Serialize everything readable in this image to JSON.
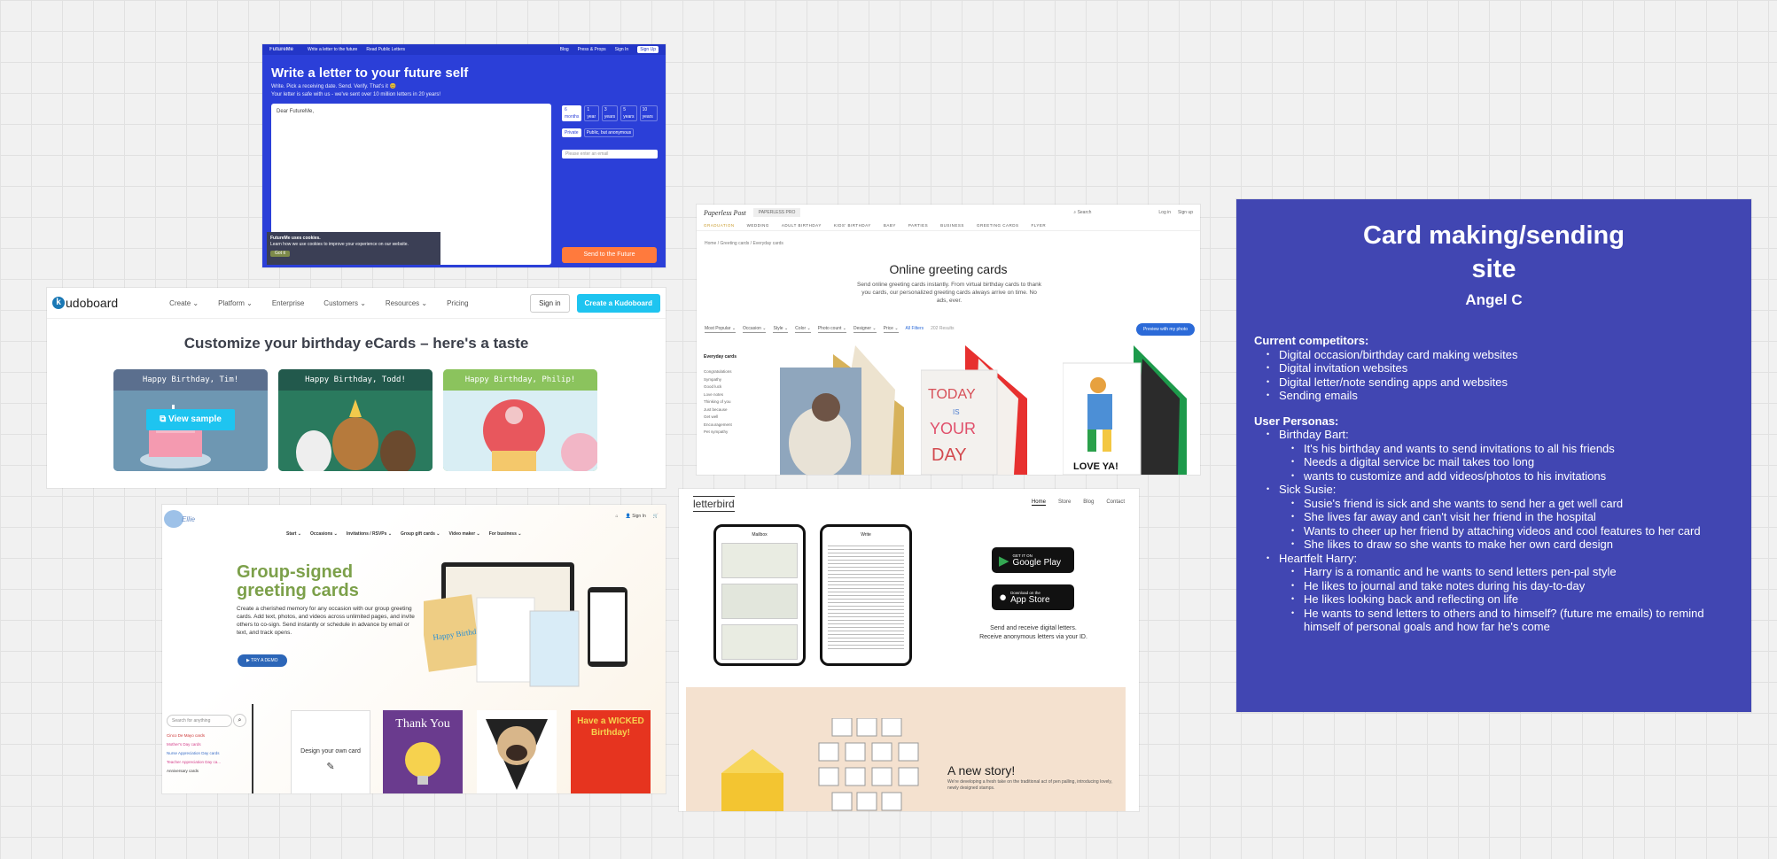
{
  "futureme": {
    "nav_logo": "FutureMe",
    "nav_links": [
      "Write a letter to the future",
      "Read Public Letters"
    ],
    "nav_right": [
      "Blog",
      "Press & Props"
    ],
    "sign_in": "Sign In",
    "sign_up": "Sign Up",
    "title": "Write a letter to your future self",
    "sub1": "Write. Pick a receiving date. Send. Verify. That's it 😊",
    "sub2": "Your letter is safe with us - we've sent over 10 million letters in 20 years!",
    "letter_placeholder": "Dear FutureMe,",
    "options": [
      "6 months",
      "1 year",
      "3 years",
      "5 years",
      "10 years"
    ],
    "privacy": [
      "Private",
      "Public, but anonymous"
    ],
    "email_placeholder": "Please enter an email",
    "cookie_title": "FutureMe uses cookies.",
    "cookie_text": "Learn how we use cookies to improve your experience on our website.",
    "cookie_btn": "Got it",
    "send": "Send to the Future"
  },
  "kudoboard": {
    "logo": "udoboard",
    "logo_k": "k",
    "menu": [
      "Create ⌄",
      "Platform ⌄",
      "Enterprise",
      "Customers ⌄",
      "Resources ⌄",
      "Pricing"
    ],
    "signin": "Sign in",
    "create": "Create a Kudoboard",
    "heading": "Customize your birthday eCards – here's a taste",
    "cards": [
      "Happy Birthday, Tim!",
      "Happy Birthday, Todd!",
      "Happy Birthday, Philip!"
    ],
    "view_sample": "View sample"
  },
  "greeting": {
    "logo1": "Paperless Post",
    "logo2": "PAPERLESS PRO",
    "search": "Search",
    "login": "Log in",
    "signup": "Sign up",
    "cats": [
      "GRADUATION",
      "WEDDING",
      "ADULT BIRTHDAY",
      "KIDS' BIRTHDAY",
      "BABY",
      "PARTIES",
      "BUSINESS",
      "GREETING CARDS",
      "FLYER"
    ],
    "breadcrumb": "Home  /  Greeting cards  /  Everyday cards",
    "title": "Online greeting cards",
    "desc": "Send online greeting cards instantly. From virtual birthday cards to thank you cards, our personalized greeting cards always arrive on time. No ads, ever.",
    "filters": [
      "Most Popular ⌄",
      "Occasion ⌄",
      "Style ⌄",
      "Color ⌄",
      "Photo count ⌄",
      "Designer ⌄",
      "Price ⌄",
      "All Filters",
      "202 Results"
    ],
    "preview": "Preview with my photo",
    "side_title": "Everyday cards",
    "side_items": [
      "Congratulations",
      "Sympathy",
      "Good luck",
      "Love notes",
      "Thinking of you",
      "Just because",
      "Get well",
      "Encouragement",
      "Pet sympathy"
    ],
    "card2_lines": [
      "TODAY",
      "IS",
      "YOUR",
      "DAY"
    ],
    "card3_text": "LOVE YA!"
  },
  "ellie": {
    "logo": "Ellie",
    "top_right": [
      "Sign In"
    ],
    "menu": [
      "Start ⌄",
      "Occasions ⌄",
      "Invitations / RSVPs ⌄",
      "Group gift cards ⌄",
      "Video maker ⌄",
      "For business ⌄"
    ],
    "title": "Group-signed greeting cards",
    "para": "Create a cherished memory for any occasion with our group greeting cards. Add text, photos, and videos across unlimited pages, and invite others to co-sign. Send instantly or schedule in advance by email or text, and track opens.",
    "try": "TRY A DEMO",
    "search": "Search for anything",
    "list": [
      "Cinco De Mayo cards",
      "Mother's Day cards",
      "Nurse Appreciation Day cards",
      "Teacher Appreciation Day ca...",
      "Anniversary cards"
    ],
    "design": "Design your own card",
    "thanks": "Thank You",
    "wicked": "Have a WICKED Birthday!",
    "happy": "Happy Birthday!"
  },
  "letterbird": {
    "logo": "letterbird",
    "menu": [
      "Home",
      "Store",
      "Blog",
      "Contact"
    ],
    "gp_top": "GET IT ON",
    "gp": "Google Play",
    "as_top": "Download on the",
    "as": "App Store",
    "recv1": "Send and receive digital letters.",
    "recv2": "Receive anonymous letters via your ID.",
    "phone1": "Mailbox",
    "phone2": "Write",
    "story_title": "A new story!",
    "story_text": "We're developing a fresh take on the traditional act of pen palling, introducing lovely, newly designed stamps."
  },
  "sticky": {
    "title": "Card making/sending site",
    "author": "Angel C",
    "competitors_heading": "Current competitors:",
    "competitors": [
      "Digital occasion/birthday card making websites",
      "Digital invitation websites",
      "Digital letter/note sending apps and websites",
      "Sending emails"
    ],
    "personas_heading": "User Personas:",
    "personas": [
      {
        "name": "Birthday Bart:",
        "points": [
          "It's his birthday and wants to send invitations to all his friends",
          "Needs a digital service bc mail takes too long",
          "wants to customize and add videos/photos to his invitations"
        ]
      },
      {
        "name": "Sick Susie:",
        "points": [
          "Susie's friend is sick and she wants to send her a get well card",
          "She lives far away and can't visit her friend in the hospital",
          "Wants to cheer up her friend by attaching videos and cool features to her card",
          "She likes to draw so she wants to make her own card design"
        ]
      },
      {
        "name": "Heartfelt Harry:",
        "points": [
          "Harry is a romantic and he wants to send letters pen-pal style",
          "He likes to journal and take notes during his day-to-day",
          "He likes looking back and reflecting on life",
          "He wants to send letters to others and to himself? (future me emails) to remind himself of personal goals and how far he's come"
        ]
      }
    ]
  },
  "colors": {
    "sticky_bg": "#4146b2",
    "futureme_bg": "#2b3fd8",
    "kudoboard_accent": "#1ec4f0",
    "ellie_green": "#7ca04a"
  }
}
